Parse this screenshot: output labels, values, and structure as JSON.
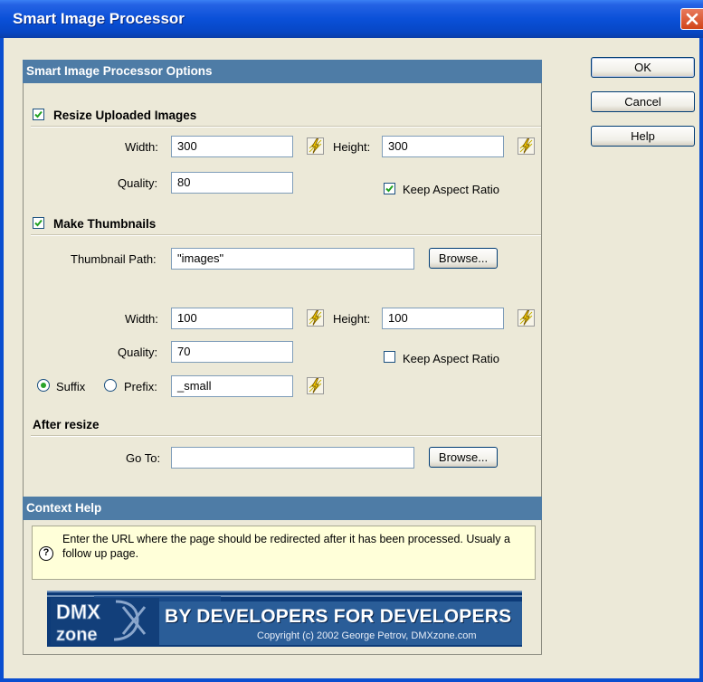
{
  "window": {
    "title": "Smart Image Processor"
  },
  "side_buttons": {
    "ok": "OK",
    "cancel": "Cancel",
    "help": "Help"
  },
  "options": {
    "header": "Smart Image Processor Options",
    "resize": {
      "label": "Resize Uploaded Images",
      "checked": true,
      "width_label": "Width:",
      "width_value": "300",
      "height_label": "Height:",
      "height_value": "300",
      "quality_label": "Quality:",
      "quality_value": "80",
      "keep_aspect_label": "Keep Aspect Ratio",
      "keep_aspect_checked": true
    },
    "thumbnails": {
      "label": "Make Thumbnails",
      "checked": true,
      "path_label": "Thumbnail Path:",
      "path_value": "\"images\"",
      "browse_label": "Browse...",
      "width_label": "Width:",
      "width_value": "100",
      "height_label": "Height:",
      "height_value": "100",
      "quality_label": "Quality:",
      "quality_value": "70",
      "keep_aspect_label": "Keep Aspect Ratio",
      "keep_aspect_checked": false,
      "suffix_label": "Suffix",
      "prefix_label": "Prefix:",
      "suffix_selected": true,
      "affix_value": "_small"
    },
    "after_resize": {
      "label": "After resize",
      "goto_label": "Go To:",
      "goto_value": "",
      "browse_label": "Browse..."
    }
  },
  "context_help": {
    "header": "Context Help",
    "text": "Enter the URL where the page should be redirected after it has been processed. Usualy a follow up page.",
    "icon": "question-icon"
  },
  "banner": {
    "logo_top": "DMX",
    "logo_bottom": "zone",
    "slogan": "BY DEVELOPERS FOR DEVELOPERS",
    "copyright": "Copyright (c) 2002 George Petrov, DMXzone.com"
  },
  "colors": {
    "titlebar": "#0a50d8",
    "section_header": "#4e7ca6",
    "dialog_bg": "#ece9d8",
    "help_bg": "#ffffd9"
  }
}
